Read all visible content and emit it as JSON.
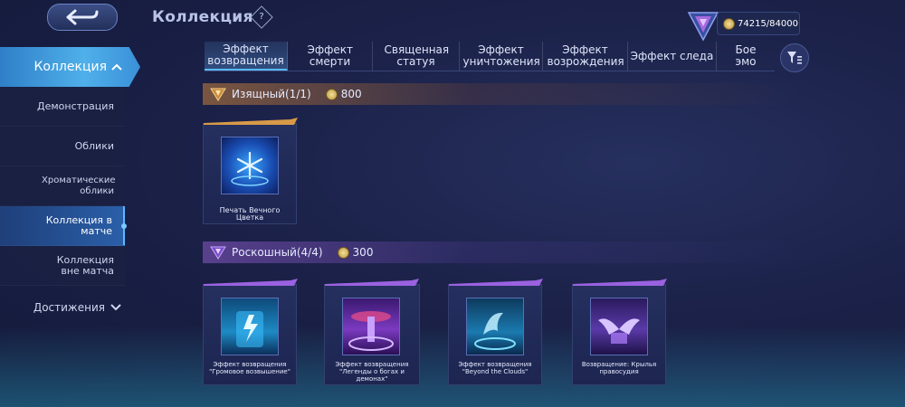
{
  "header": {
    "title": "Коллекция",
    "help_symbol": "?",
    "currency": "74215/84000"
  },
  "sidebar": {
    "active_group": "Коллекция",
    "items": [
      {
        "label": "Демонстрация"
      },
      {
        "label": "Облики"
      },
      {
        "label": "Хроматические облики"
      },
      {
        "label": "Коллекция в матче"
      },
      {
        "label": "Коллекция вне матча"
      }
    ],
    "achievements": "Достижения"
  },
  "tabs": [
    {
      "label": "Эффект возвращения"
    },
    {
      "label": "Эффект смерти"
    },
    {
      "label": "Священная статуя"
    },
    {
      "label": "Эффект уничтожения"
    },
    {
      "label": "Эффект возрождения"
    },
    {
      "label": "Эффект следа"
    },
    {
      "label": "Бое эмо"
    }
  ],
  "sections": [
    {
      "name": "Изящный(1/1)",
      "price": "800",
      "color": "#c98a3c",
      "items": [
        {
          "caption": "Печать Вечного Цветка"
        }
      ]
    },
    {
      "name": "Роскошный(4/4)",
      "price": "300",
      "color": "#8a5ad0",
      "items": [
        {
          "caption": "Эффект возвращения \"Громовое возвышение\""
        },
        {
          "caption": "Эффект возвращения \"Легенды о богах и демонах\""
        },
        {
          "caption": "Эффект возвращения \"Beyond the Clouds\""
        },
        {
          "caption": "Возвращение: Крылья правосудия"
        }
      ]
    }
  ],
  "icons": [
    "back-arrow-icon",
    "help-icon",
    "chevron-up-icon",
    "chevron-down-icon",
    "filter-icon",
    "gold-rank-icon",
    "purple-rank-icon",
    "coin-icon"
  ]
}
